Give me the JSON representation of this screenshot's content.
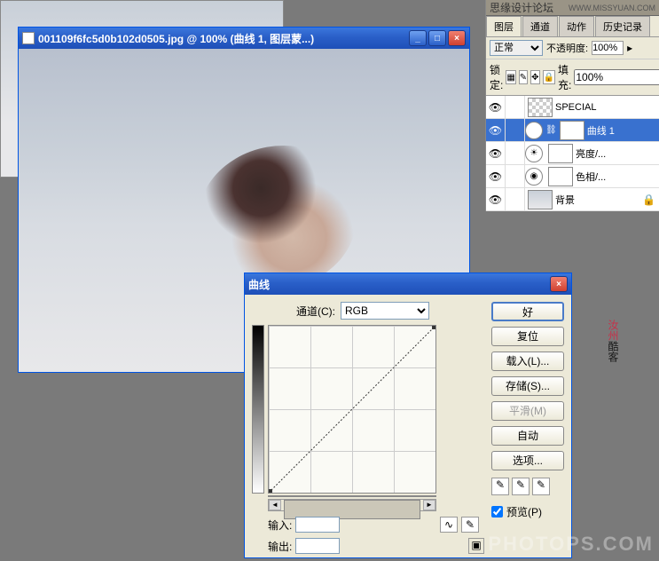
{
  "doc_window": {
    "title": "001109f6fc5d0b102d0505.jpg @ 100% (曲线 1, 图层蒙...)"
  },
  "curves": {
    "title": "曲线",
    "channel_label": "通道(C):",
    "channel_value": "RGB",
    "input_label": "输入:",
    "output_label": "输出:",
    "buttons": {
      "ok": "好",
      "reset": "复位",
      "load": "载入(L)...",
      "save": "存储(S)...",
      "smooth": "平滑(M)",
      "auto": "自动",
      "options": "选项..."
    },
    "preview_label": "预览(P)"
  },
  "layers_panel": {
    "header": "思缘设计论坛",
    "wm_url": "WWW.MISSYUAN.COM",
    "tabs": [
      "图层",
      "通道",
      "动作",
      "历史记录"
    ],
    "blend_mode": "正常",
    "opacity_label": "不透明度:",
    "opacity_value": "100%",
    "lock_label": "锁定:",
    "fill_label": "填充:",
    "fill_value": "100%",
    "layers": [
      {
        "name": "SPECIAL",
        "kind": "fill"
      },
      {
        "name": "曲线 1",
        "kind": "adj",
        "active": true
      },
      {
        "name": "亮度/...",
        "kind": "adj"
      },
      {
        "name": "色相/...",
        "kind": "adj"
      },
      {
        "name": "背景",
        "kind": "bg"
      }
    ]
  },
  "watermark": "PHOTOPS.COM",
  "stamp": {
    "red": "汝州",
    "black": "酷客"
  }
}
